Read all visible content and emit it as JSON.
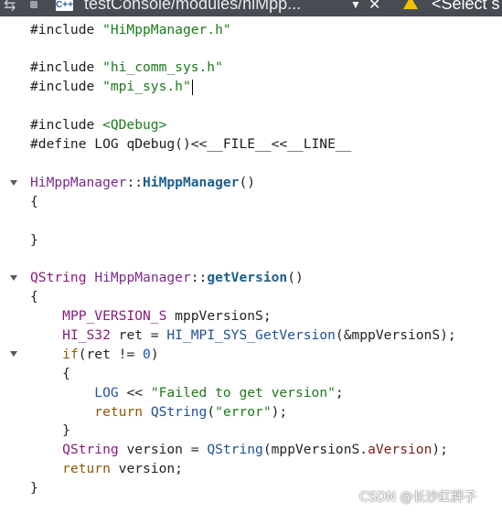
{
  "tab": {
    "path": "testConsole/modules/hiMpp...",
    "file_icon_text": "C++",
    "symbol": "<Select s",
    "icons": [
      "navigate-icon",
      "lock-icon",
      "cpp-file-icon",
      "chevron-down-icon",
      "close-icon",
      "warning-icon"
    ]
  },
  "code": {
    "inc1_kw": "#include ",
    "inc1_path": "\"HiMppManager.h\"",
    "inc2_kw": "#include ",
    "inc2_path": "\"hi_comm_sys.h\"",
    "inc3_kw": "#include ",
    "inc3_path": "\"mpi_sys.h\"",
    "inc4_kw": "#include ",
    "inc4_path": "<QDebug>",
    "def_kw": "#define ",
    "def_name": "LOG",
    "def_rest": " qDebug()<<__FILE__<<__LINE__",
    "ctor_cls": "HiMppManager",
    "ctor_sep": "::",
    "ctor_fn": "HiMppManager",
    "ctor_paren": "()",
    "brace_open": "{",
    "brace_close": "}",
    "gv_ret": "QString",
    "gv_cls": "HiMppManager",
    "gv_sep": "::",
    "gv_fn": "getVersion",
    "gv_paren": "()",
    "l_decl_type": "MPP_VERSION_S",
    "l_decl_var": " mppVersionS;",
    "l_ret_type": "HI_S32",
    "l_ret_mid": " ret = ",
    "l_ret_fn": "HI_MPI_SYS_GetVersion",
    "l_ret_arg": "(&mppVersionS);",
    "l_if_kw": "if",
    "l_if_cond": "(ret != ",
    "l_if_num": "0",
    "l_if_close": ")",
    "l_log_macro": "LOG",
    "l_log_op": " << ",
    "l_log_str": "\"Failed to get version\"",
    "l_log_semi": ";",
    "l_ret1_kw": "return",
    "l_ret1_fn": "QString",
    "l_ret1_open": "(",
    "l_ret1_str": "\"error\"",
    "l_ret1_close": ");",
    "l_ver_type": "QString",
    "l_ver_mid": " version = ",
    "l_ver_fn": "QString",
    "l_ver_arg": "(mppVersionS.",
    "l_ver_member": "aVersion",
    "l_ver_close": ");",
    "l_ret2_kw": "return",
    "l_ret2_var": " version;"
  },
  "watermark": "CSDN @长沙红胖子",
  "colors": {
    "tab_bar": "#474c52",
    "string": "#1b7a1b",
    "type": "#1f55a8",
    "function": "#1e5e8c",
    "keyword": "#8c5a00"
  }
}
